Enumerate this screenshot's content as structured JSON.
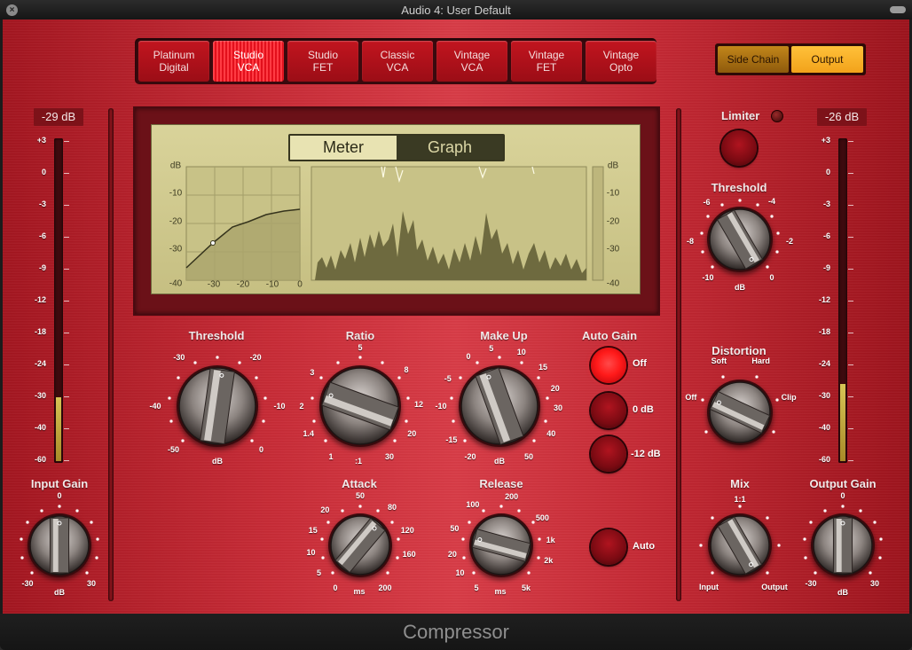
{
  "window": {
    "title": "Audio 4: User Default"
  },
  "footer": {
    "plugin_name": "Compressor"
  },
  "models": [
    {
      "label_1": "Platinum",
      "label_2": "Digital",
      "active": false
    },
    {
      "label_1": "Studio",
      "label_2": "VCA",
      "active": true
    },
    {
      "label_1": "Studio",
      "label_2": "FET",
      "active": false
    },
    {
      "label_1": "Classic",
      "label_2": "VCA",
      "active": false
    },
    {
      "label_1": "Vintage",
      "label_2": "VCA",
      "active": false
    },
    {
      "label_1": "Vintage",
      "label_2": "FET",
      "active": false
    },
    {
      "label_1": "Vintage",
      "label_2": "Opto",
      "active": false
    }
  ],
  "routing": {
    "side_chain_label": "Side Chain",
    "output_label": "Output",
    "selected": "Output"
  },
  "input_meter": {
    "value_text": "-29 dB",
    "level_fraction": 0.2
  },
  "output_meter": {
    "value_text": "-26 dB",
    "level_fraction": 0.24
  },
  "meter_scale": [
    "+3",
    "0",
    "-3",
    "-6",
    "-9",
    "-12",
    "-18",
    "-24",
    "-30",
    "-40",
    "-60"
  ],
  "display": {
    "tabs": {
      "meter": "Meter",
      "graph": "Graph",
      "selected": "Graph"
    },
    "left_axis": [
      "dB",
      "-10",
      "-20",
      "-30",
      "-40"
    ],
    "bottom_axis": [
      "-30",
      "-20",
      "-10",
      "0"
    ],
    "right_axis": [
      "dB",
      "-10",
      "-20",
      "-30",
      "-40"
    ]
  },
  "knobs": {
    "threshold": {
      "title": "Threshold",
      "unit": "dB",
      "labels": [
        "-50",
        "-40",
        "-30",
        "-20",
        "-10",
        "0"
      ]
    },
    "ratio": {
      "title": "Ratio",
      "unit": ":1",
      "labels": [
        "1",
        "1.4",
        "2",
        "3",
        "5",
        "8",
        "12",
        "20",
        "30"
      ]
    },
    "makeup": {
      "title": "Make Up",
      "unit": "dB",
      "labels": [
        "-20",
        "-15",
        "-10",
        "-5",
        "0",
        "5",
        "10",
        "15",
        "20",
        "30",
        "40",
        "50"
      ]
    },
    "attack": {
      "title": "Attack",
      "unit": "ms",
      "labels": [
        "0",
        "5",
        "10",
        "15",
        "20",
        "50",
        "80",
        "120",
        "160",
        "200"
      ]
    },
    "release": {
      "title": "Release",
      "unit": "ms",
      "labels": [
        "5",
        "10",
        "20",
        "50",
        "100",
        "200",
        "500",
        "1k",
        "2k",
        "5k"
      ]
    },
    "input_gain": {
      "title": "Input Gain",
      "unit": "dB",
      "labels": [
        "-30",
        "0",
        "30"
      ]
    },
    "output_gain": {
      "title": "Output Gain",
      "unit": "dB",
      "labels": [
        "-30",
        "0",
        "30"
      ]
    },
    "limiter_threshold": {
      "title": "Threshold",
      "unit": "dB",
      "labels": [
        "-10",
        "-8",
        "-6",
        "-4",
        "-2",
        "0"
      ]
    },
    "distortion": {
      "title": "Distortion",
      "labels": [
        "Off",
        "Soft",
        "Hard",
        "Clip"
      ]
    },
    "mix": {
      "title": "Mix",
      "labels": [
        "Input",
        "1:1",
        "Output"
      ]
    }
  },
  "auto_gain": {
    "title": "Auto Gain",
    "options": [
      "Off",
      "0 dB",
      "-12 dB"
    ],
    "selected": "Off",
    "auto_label": "Auto"
  },
  "limiter": {
    "title": "Limiter"
  }
}
